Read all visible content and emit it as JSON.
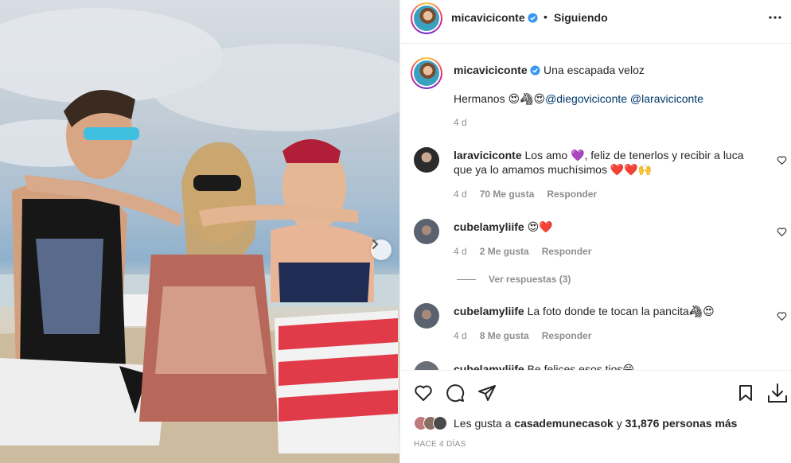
{
  "photo": {
    "alt_icon": "chevron-right-icon"
  },
  "header": {
    "username": "micaviciconte",
    "separator": "•",
    "follow_status": "Siguiendo",
    "more_icon": "more-horizontal-icon"
  },
  "caption": {
    "username": "micaviciconte",
    "text": "Una escapada veloz",
    "line2_prefix": "Hermanos 😍🦓😍",
    "mention1": "@diegoviciconte",
    "mention2": "@laraviciconte",
    "time": "4 d"
  },
  "comments": [
    {
      "username": "laraviciconte",
      "text": "Los amo 💜, feliz de tenerlos y recibir a luca que ya lo amamos muchísimos ❤️❤️🙌",
      "time": "4 d",
      "likes": "70 Me gusta",
      "reply": "Responder"
    },
    {
      "username": "cubelamyliife",
      "text": "😍❤️",
      "time": "4 d",
      "likes": "2 Me gusta",
      "reply": "Responder"
    },
    {
      "username": "cubelamyliife",
      "text": "La foto donde te tocan la pancita🦓😍",
      "time": "4 d",
      "likes": "8 Me gusta",
      "reply": "Responder"
    }
  ],
  "view_replies": "Ver respuestas (3)",
  "partial_comment": {
    "username": "cubelamyliife",
    "text": "Be felices esos tios😄"
  },
  "likes": {
    "prefix": "Les gusta a",
    "user": "casademunecasok",
    "connector": "y",
    "others": "31,876 personas más"
  },
  "post_date": "HACE 4 DÍAS",
  "colors": {
    "verified": "#3897f0",
    "mention": "#00376b",
    "muted": "#8e8e8e",
    "border": "#efefef"
  }
}
